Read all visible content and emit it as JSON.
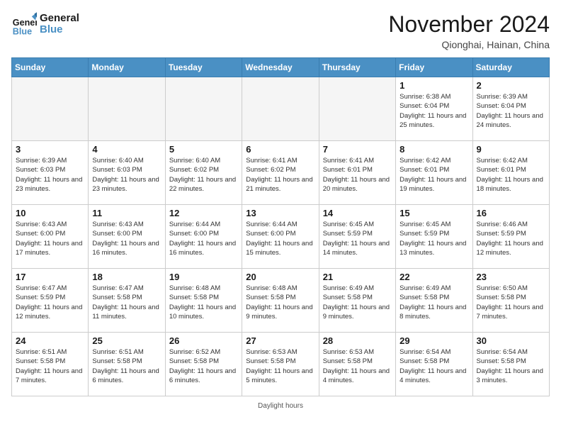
{
  "header": {
    "logo_general": "General",
    "logo_blue": "Blue",
    "month_title": "November 2024",
    "location": "Qionghai, Hainan, China"
  },
  "days_of_week": [
    "Sunday",
    "Monday",
    "Tuesday",
    "Wednesday",
    "Thursday",
    "Friday",
    "Saturday"
  ],
  "weeks": [
    [
      {
        "day": "",
        "empty": true
      },
      {
        "day": "",
        "empty": true
      },
      {
        "day": "",
        "empty": true
      },
      {
        "day": "",
        "empty": true
      },
      {
        "day": "",
        "empty": true
      },
      {
        "day": "1",
        "sunrise": "6:38 AM",
        "sunset": "6:04 PM",
        "daylight": "11 hours and 25 minutes."
      },
      {
        "day": "2",
        "sunrise": "6:39 AM",
        "sunset": "6:04 PM",
        "daylight": "11 hours and 24 minutes."
      }
    ],
    [
      {
        "day": "3",
        "sunrise": "6:39 AM",
        "sunset": "6:03 PM",
        "daylight": "11 hours and 23 minutes."
      },
      {
        "day": "4",
        "sunrise": "6:40 AM",
        "sunset": "6:03 PM",
        "daylight": "11 hours and 23 minutes."
      },
      {
        "day": "5",
        "sunrise": "6:40 AM",
        "sunset": "6:02 PM",
        "daylight": "11 hours and 22 minutes."
      },
      {
        "day": "6",
        "sunrise": "6:41 AM",
        "sunset": "6:02 PM",
        "daylight": "11 hours and 21 minutes."
      },
      {
        "day": "7",
        "sunrise": "6:41 AM",
        "sunset": "6:01 PM",
        "daylight": "11 hours and 20 minutes."
      },
      {
        "day": "8",
        "sunrise": "6:42 AM",
        "sunset": "6:01 PM",
        "daylight": "11 hours and 19 minutes."
      },
      {
        "day": "9",
        "sunrise": "6:42 AM",
        "sunset": "6:01 PM",
        "daylight": "11 hours and 18 minutes."
      }
    ],
    [
      {
        "day": "10",
        "sunrise": "6:43 AM",
        "sunset": "6:00 PM",
        "daylight": "11 hours and 17 minutes."
      },
      {
        "day": "11",
        "sunrise": "6:43 AM",
        "sunset": "6:00 PM",
        "daylight": "11 hours and 16 minutes."
      },
      {
        "day": "12",
        "sunrise": "6:44 AM",
        "sunset": "6:00 PM",
        "daylight": "11 hours and 16 minutes."
      },
      {
        "day": "13",
        "sunrise": "6:44 AM",
        "sunset": "6:00 PM",
        "daylight": "11 hours and 15 minutes."
      },
      {
        "day": "14",
        "sunrise": "6:45 AM",
        "sunset": "5:59 PM",
        "daylight": "11 hours and 14 minutes."
      },
      {
        "day": "15",
        "sunrise": "6:45 AM",
        "sunset": "5:59 PM",
        "daylight": "11 hours and 13 minutes."
      },
      {
        "day": "16",
        "sunrise": "6:46 AM",
        "sunset": "5:59 PM",
        "daylight": "11 hours and 12 minutes."
      }
    ],
    [
      {
        "day": "17",
        "sunrise": "6:47 AM",
        "sunset": "5:59 PM",
        "daylight": "11 hours and 12 minutes."
      },
      {
        "day": "18",
        "sunrise": "6:47 AM",
        "sunset": "5:58 PM",
        "daylight": "11 hours and 11 minutes."
      },
      {
        "day": "19",
        "sunrise": "6:48 AM",
        "sunset": "5:58 PM",
        "daylight": "11 hours and 10 minutes."
      },
      {
        "day": "20",
        "sunrise": "6:48 AM",
        "sunset": "5:58 PM",
        "daylight": "11 hours and 9 minutes."
      },
      {
        "day": "21",
        "sunrise": "6:49 AM",
        "sunset": "5:58 PM",
        "daylight": "11 hours and 9 minutes."
      },
      {
        "day": "22",
        "sunrise": "6:49 AM",
        "sunset": "5:58 PM",
        "daylight": "11 hours and 8 minutes."
      },
      {
        "day": "23",
        "sunrise": "6:50 AM",
        "sunset": "5:58 PM",
        "daylight": "11 hours and 7 minutes."
      }
    ],
    [
      {
        "day": "24",
        "sunrise": "6:51 AM",
        "sunset": "5:58 PM",
        "daylight": "11 hours and 7 minutes."
      },
      {
        "day": "25",
        "sunrise": "6:51 AM",
        "sunset": "5:58 PM",
        "daylight": "11 hours and 6 minutes."
      },
      {
        "day": "26",
        "sunrise": "6:52 AM",
        "sunset": "5:58 PM",
        "daylight": "11 hours and 6 minutes."
      },
      {
        "day": "27",
        "sunrise": "6:53 AM",
        "sunset": "5:58 PM",
        "daylight": "11 hours and 5 minutes."
      },
      {
        "day": "28",
        "sunrise": "6:53 AM",
        "sunset": "5:58 PM",
        "daylight": "11 hours and 4 minutes."
      },
      {
        "day": "29",
        "sunrise": "6:54 AM",
        "sunset": "5:58 PM",
        "daylight": "11 hours and 4 minutes."
      },
      {
        "day": "30",
        "sunrise": "6:54 AM",
        "sunset": "5:58 PM",
        "daylight": "11 hours and 3 minutes."
      }
    ]
  ],
  "daylight_note": "Daylight hours"
}
